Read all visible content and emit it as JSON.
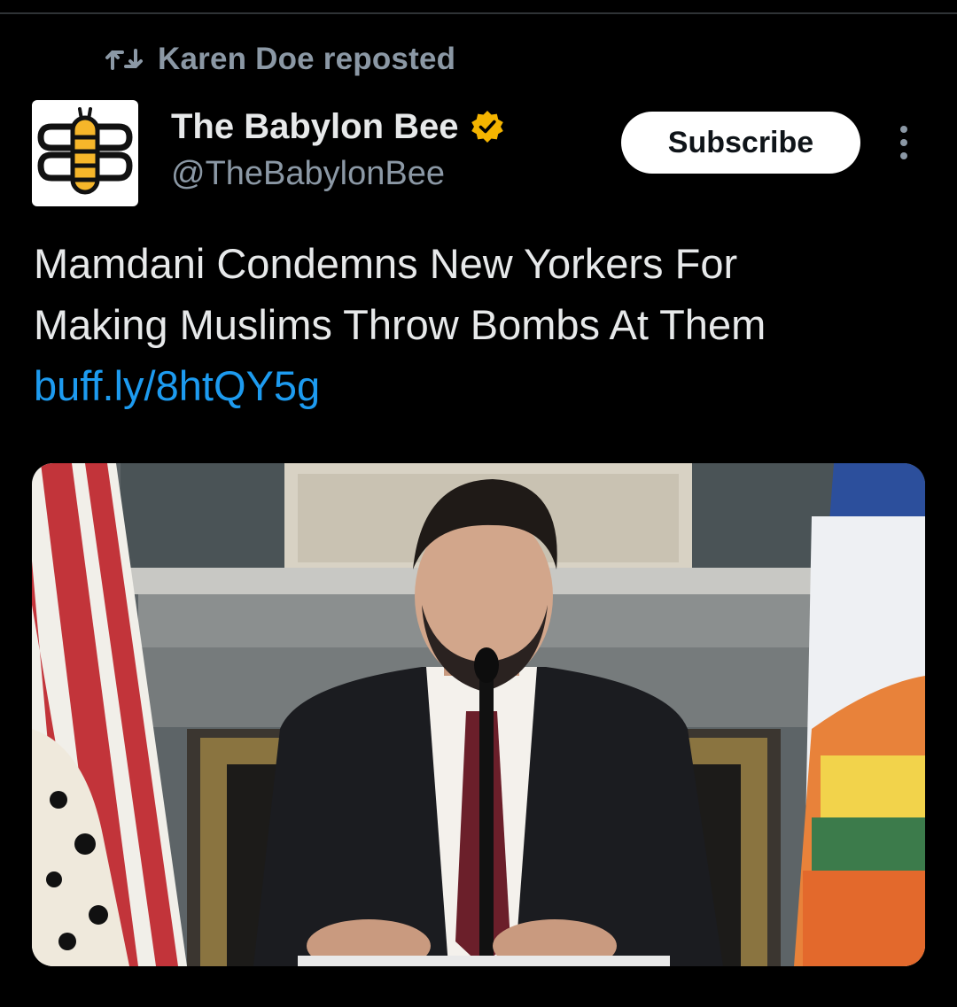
{
  "repost": {
    "icon": "repost-icon",
    "text": "Karen Doe reposted"
  },
  "author": {
    "name": "The Babylon Bee",
    "handle": "@TheBabylonBee",
    "verified": true,
    "verified_color": "#f4b400",
    "avatar_icon": "bee-logo"
  },
  "subscribe_label": "Subscribe",
  "more_icon": "more-vertical-icon",
  "tweet": {
    "line1": "Mamdani Condemns New Yorkers For",
    "line2": "Making Muslims Throw Bombs At Them",
    "link": "buff.ly/8htQY5g"
  },
  "media": {
    "type": "photo"
  },
  "colors": {
    "background": "#000000",
    "text_primary": "#e7e9ea",
    "text_secondary": "#8b98a5",
    "link": "#1d9bf0"
  }
}
